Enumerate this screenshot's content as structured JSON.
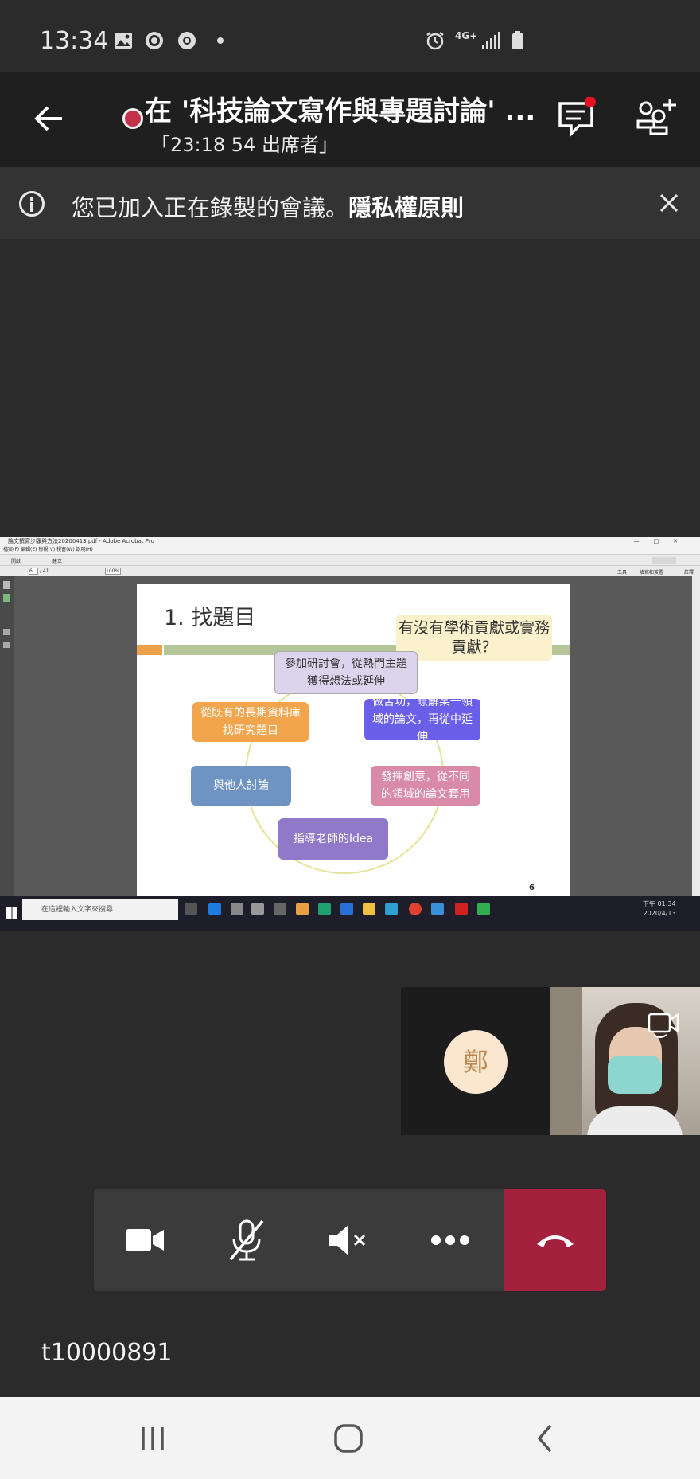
{
  "status_bar": {
    "time": "13:34",
    "network": "4G+",
    "icons": [
      "gallery-icon",
      "app-icon",
      "chrome-icon",
      "dot-icon",
      "alarm-icon",
      "signal-icon",
      "battery-icon"
    ]
  },
  "meeting": {
    "title": "在 '科技論文寫作與專題討論' ...",
    "subtitle": "「23:18 54 出席者」",
    "recording_color": "#c4314b"
  },
  "banner": {
    "text": "您已加入正在錄製的會議。",
    "link": "隱私權原則"
  },
  "shared_screen": {
    "window_title": "論文撰寫步驟與方法20200413.pdf - Adobe Acrobat Pro",
    "menu": "檔案(F)   編輯(E)   檢視(V)   視窗(W)   說明(H)",
    "toolbar_open": "開啟",
    "toolbar_create": "建立",
    "page_field": "6",
    "page_total": "/ 41",
    "zoom": "100%",
    "tools_label": "工具",
    "sign_label": "填寫和簽署",
    "comment_label": "註釋",
    "slide": {
      "title": "1. 找題目",
      "callout": "有沒有學術貢獻或實務貢獻？",
      "nodes": [
        "參加研討會，從熱門主題獲得想法或延伸",
        "做苦功，瞭解某一領域的論文，再從中延伸",
        "發揮創意，從不同的領域的論文套用",
        "指導老師的Idea",
        "與他人討論",
        "從既有的長期資料庫找研究題目"
      ],
      "page_number": "6"
    },
    "taskbar": {
      "search_placeholder": "在這裡輸入文字來搜尋",
      "clock_time": "下午 01:34",
      "clock_date": "2020/4/13"
    }
  },
  "participants": {
    "avatar_initial": "鄭",
    "avatar_bg": "#fbe6cf"
  },
  "controls": {
    "buttons": [
      "camera-button",
      "mic-muted-button",
      "speaker-muted-button",
      "more-options-button",
      "hang-up-button"
    ],
    "hangup_color": "#a4213d"
  },
  "user_id": "t10000891"
}
